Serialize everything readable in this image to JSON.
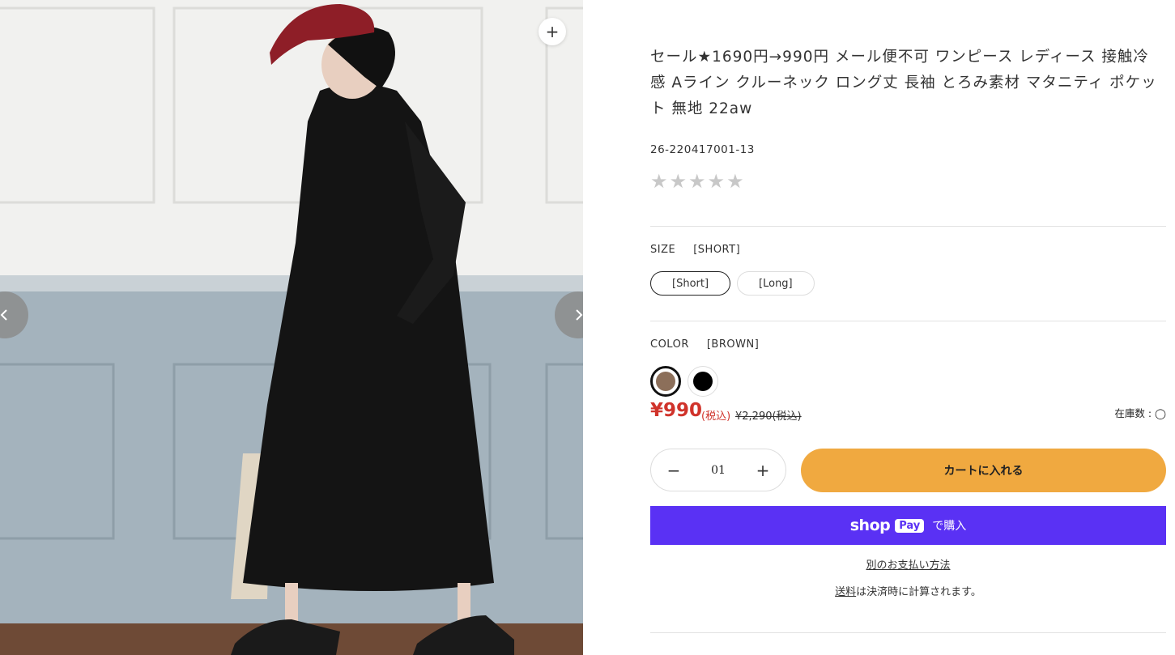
{
  "product": {
    "title": "セール★1690円→990円 メール便不可 ワンピース レディース 接触冷感 Aライン クルーネック ロング丈 長袖 とろみ素材 マタニティ ポケット 無地 22aw",
    "sku": "26-220417001-13",
    "rating_stars": 5
  },
  "gallery": {
    "zoom_icon": "plus-icon",
    "prev_icon": "chevron-left-icon",
    "next_icon": "chevron-right-icon"
  },
  "size": {
    "label": "SIZE",
    "selected": "[SHORT]",
    "options": [
      "[Short]",
      "[Long]"
    ]
  },
  "color": {
    "label": "COLOR",
    "selected": "[BROWN]",
    "swatches": [
      {
        "name": "brown",
        "hex": "#8c6f5a"
      },
      {
        "name": "black",
        "hex": "#000000"
      }
    ]
  },
  "price": {
    "current": "¥990",
    "tax_note": "(税込)",
    "compare": "¥2,290(税込)",
    "stock": "在庫数 : ◯",
    "color_sale": "#d0332b"
  },
  "cart": {
    "quantity": "01",
    "add_label": "カートに入れる",
    "button_color": "#f0a940"
  },
  "shoppay": {
    "brand": "shop",
    "pay": "Pay",
    "buy": "で購入",
    "color": "#5a31f4"
  },
  "more_payment": "別のお支払い方法",
  "shipping": {
    "link": "送料",
    "text": "は決済時に計算されます。"
  }
}
